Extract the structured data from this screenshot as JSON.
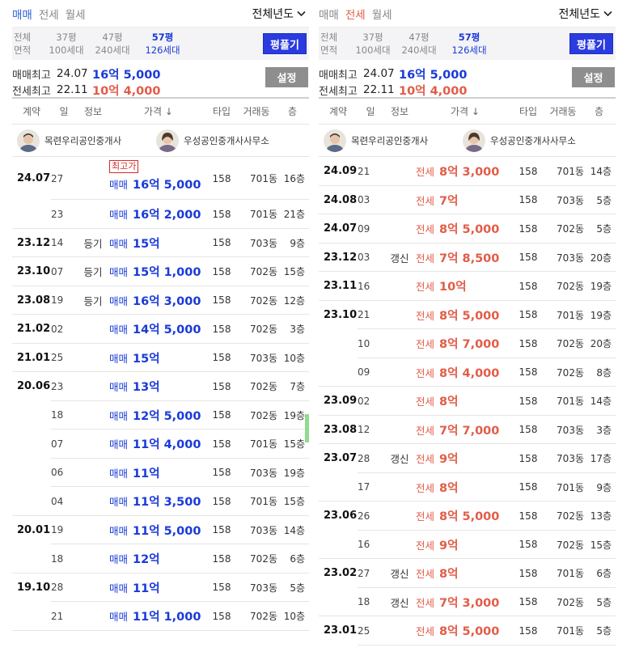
{
  "left": {
    "tabs": [
      {
        "label": "매매",
        "state": "active"
      },
      {
        "label": "전세",
        "state": "inactive"
      },
      {
        "label": "월세",
        "state": "inactive"
      }
    ],
    "year_select": "전체년도",
    "area": {
      "head_top": "전체",
      "head_bottom": "면적",
      "cols": [
        {
          "top": "37평",
          "bottom": "100세대"
        },
        {
          "top": "47평",
          "bottom": "240세대"
        },
        {
          "top": "57평",
          "bottom": "126세대"
        }
      ],
      "button": "평풀기"
    },
    "max": {
      "sale_label": "매매최고",
      "sale_date": "24.07",
      "sale_price": "16억 5,000",
      "jeonse_label": "전세최고",
      "jeonse_date": "22.11",
      "jeonse_price": "10억 4,000",
      "button": "설정"
    },
    "headers": {
      "contract": "계약",
      "day": "일",
      "info": "정보",
      "price": "가격 ↓",
      "type": "타입",
      "dong": "거래동",
      "floor": "층"
    },
    "agents": [
      {
        "name": "목련우리공인중개사"
      },
      {
        "name": "우성공인중개사사무소"
      }
    ],
    "rows": [
      {
        "date": "24.07",
        "day": "27",
        "info": "",
        "kind": "매매",
        "price": "16억 5,000",
        "type": "158",
        "dong": "701동",
        "floor": "16층",
        "badge": "최고가",
        "first": true,
        "last": false
      },
      {
        "date": "",
        "day": "23",
        "info": "",
        "kind": "매매",
        "price": "16억 2,000",
        "type": "158",
        "dong": "701동",
        "floor": "21층",
        "badge": "",
        "first": false,
        "last": true
      },
      {
        "date": "23.12",
        "day": "14",
        "info": "등기",
        "kind": "매매",
        "price": "15억",
        "type": "158",
        "dong": "703동",
        "floor": "9층",
        "badge": "",
        "first": true,
        "last": true
      },
      {
        "date": "23.10",
        "day": "07",
        "info": "등기",
        "kind": "매매",
        "price": "15억 1,000",
        "type": "158",
        "dong": "702동",
        "floor": "15층",
        "badge": "",
        "first": true,
        "last": true
      },
      {
        "date": "23.08",
        "day": "19",
        "info": "등기",
        "kind": "매매",
        "price": "16억 3,000",
        "type": "158",
        "dong": "702동",
        "floor": "12층",
        "badge": "",
        "first": true,
        "last": true
      },
      {
        "date": "21.02",
        "day": "02",
        "info": "",
        "kind": "매매",
        "price": "14억 5,000",
        "type": "158",
        "dong": "702동",
        "floor": "3층",
        "badge": "",
        "first": true,
        "last": true
      },
      {
        "date": "21.01",
        "day": "25",
        "info": "",
        "kind": "매매",
        "price": "15억",
        "type": "158",
        "dong": "703동",
        "floor": "10층",
        "badge": "",
        "first": true,
        "last": true
      },
      {
        "date": "20.06",
        "day": "23",
        "info": "",
        "kind": "매매",
        "price": "13억",
        "type": "158",
        "dong": "702동",
        "floor": "7층",
        "badge": "",
        "first": true,
        "last": false
      },
      {
        "date": "",
        "day": "18",
        "info": "",
        "kind": "매매",
        "price": "12억 5,000",
        "type": "158",
        "dong": "702동",
        "floor": "19층",
        "badge": "",
        "first": false,
        "last": false
      },
      {
        "date": "",
        "day": "07",
        "info": "",
        "kind": "매매",
        "price": "11억 4,000",
        "type": "158",
        "dong": "701동",
        "floor": "15층",
        "badge": "",
        "first": false,
        "last": false
      },
      {
        "date": "",
        "day": "06",
        "info": "",
        "kind": "매매",
        "price": "11억",
        "type": "158",
        "dong": "703동",
        "floor": "19층",
        "badge": "",
        "first": false,
        "last": false
      },
      {
        "date": "",
        "day": "04",
        "info": "",
        "kind": "매매",
        "price": "11억 3,500",
        "type": "158",
        "dong": "701동",
        "floor": "15층",
        "badge": "",
        "first": false,
        "last": true
      },
      {
        "date": "20.01",
        "day": "19",
        "info": "",
        "kind": "매매",
        "price": "11억 5,000",
        "type": "158",
        "dong": "703동",
        "floor": "14층",
        "badge": "",
        "first": true,
        "last": false
      },
      {
        "date": "",
        "day": "18",
        "info": "",
        "kind": "매매",
        "price": "12억",
        "type": "158",
        "dong": "702동",
        "floor": "6층",
        "badge": "",
        "first": false,
        "last": true
      },
      {
        "date": "19.10",
        "day": "28",
        "info": "",
        "kind": "매매",
        "price": "11억",
        "type": "158",
        "dong": "703동",
        "floor": "5층",
        "badge": "",
        "first": true,
        "last": false
      },
      {
        "date": "",
        "day": "21",
        "info": "",
        "kind": "매매",
        "price": "11억 1,000",
        "type": "158",
        "dong": "702동",
        "floor": "10층",
        "badge": "",
        "first": false,
        "last": true
      }
    ]
  },
  "right": {
    "tabs": [
      {
        "label": "매매",
        "state": "inactive"
      },
      {
        "label": "전세",
        "state": "active"
      },
      {
        "label": "월세",
        "state": "inactive"
      }
    ],
    "year_select": "전체년도",
    "area": {
      "head_top": "전체",
      "head_bottom": "면적",
      "cols": [
        {
          "top": "37평",
          "bottom": "100세대"
        },
        {
          "top": "47평",
          "bottom": "240세대"
        },
        {
          "top": "57평",
          "bottom": "126세대"
        }
      ],
      "button": "평풀기"
    },
    "max": {
      "sale_label": "매매최고",
      "sale_date": "24.07",
      "sale_price": "16억 5,000",
      "jeonse_label": "전세최고",
      "jeonse_date": "22.11",
      "jeonse_price": "10억 4,000",
      "button": "설정"
    },
    "headers": {
      "contract": "계약",
      "day": "일",
      "info": "정보",
      "price": "가격 ↓",
      "type": "타입",
      "dong": "거래동",
      "floor": "층"
    },
    "agents": [
      {
        "name": "목련우리공인중개사"
      },
      {
        "name": "우성공인중개사사무소"
      }
    ],
    "rows": [
      {
        "date": "24.09",
        "day": "21",
        "info": "",
        "kind": "전세",
        "price": "8억 3,000",
        "type": "158",
        "dong": "701동",
        "floor": "14층",
        "first": true,
        "last": true
      },
      {
        "date": "24.08",
        "day": "03",
        "info": "",
        "kind": "전세",
        "price": "7억",
        "type": "158",
        "dong": "703동",
        "floor": "5층",
        "first": true,
        "last": true
      },
      {
        "date": "24.07",
        "day": "09",
        "info": "",
        "kind": "전세",
        "price": "8억 5,000",
        "type": "158",
        "dong": "702동",
        "floor": "5층",
        "first": true,
        "last": true
      },
      {
        "date": "23.12",
        "day": "03",
        "info": "갱신",
        "kind": "전세",
        "price": "7억 8,500",
        "type": "158",
        "dong": "703동",
        "floor": "20층",
        "first": true,
        "last": true
      },
      {
        "date": "23.11",
        "day": "16",
        "info": "",
        "kind": "전세",
        "price": "10억",
        "type": "158",
        "dong": "702동",
        "floor": "19층",
        "first": true,
        "last": true
      },
      {
        "date": "23.10",
        "day": "21",
        "info": "",
        "kind": "전세",
        "price": "8억 5,000",
        "type": "158",
        "dong": "701동",
        "floor": "19층",
        "first": true,
        "last": false
      },
      {
        "date": "",
        "day": "10",
        "info": "",
        "kind": "전세",
        "price": "8억 7,000",
        "type": "158",
        "dong": "702동",
        "floor": "20층",
        "first": false,
        "last": false
      },
      {
        "date": "",
        "day": "09",
        "info": "",
        "kind": "전세",
        "price": "8억 4,000",
        "type": "158",
        "dong": "702동",
        "floor": "8층",
        "first": false,
        "last": true
      },
      {
        "date": "23.09",
        "day": "02",
        "info": "",
        "kind": "전세",
        "price": "8억",
        "type": "158",
        "dong": "701동",
        "floor": "14층",
        "first": true,
        "last": true
      },
      {
        "date": "23.08",
        "day": "12",
        "info": "",
        "kind": "전세",
        "price": "7억 7,000",
        "type": "158",
        "dong": "703동",
        "floor": "3층",
        "first": true,
        "last": true
      },
      {
        "date": "23.07",
        "day": "28",
        "info": "갱신",
        "kind": "전세",
        "price": "9억",
        "type": "158",
        "dong": "703동",
        "floor": "17층",
        "first": true,
        "last": false
      },
      {
        "date": "",
        "day": "17",
        "info": "",
        "kind": "전세",
        "price": "8억",
        "type": "158",
        "dong": "701동",
        "floor": "9층",
        "first": false,
        "last": true
      },
      {
        "date": "23.06",
        "day": "26",
        "info": "",
        "kind": "전세",
        "price": "8억 5,000",
        "type": "158",
        "dong": "702동",
        "floor": "13층",
        "first": true,
        "last": false
      },
      {
        "date": "",
        "day": "16",
        "info": "",
        "kind": "전세",
        "price": "9억",
        "type": "158",
        "dong": "702동",
        "floor": "15층",
        "first": false,
        "last": true
      },
      {
        "date": "23.02",
        "day": "27",
        "info": "갱신",
        "kind": "전세",
        "price": "8억",
        "type": "158",
        "dong": "701동",
        "floor": "6층",
        "first": true,
        "last": false
      },
      {
        "date": "",
        "day": "18",
        "info": "갱신",
        "kind": "전세",
        "price": "7억 3,000",
        "type": "158",
        "dong": "702동",
        "floor": "5층",
        "first": false,
        "last": true
      },
      {
        "date": "23.01",
        "day": "25",
        "info": "",
        "kind": "전세",
        "price": "8억 5,000",
        "type": "158",
        "dong": "701동",
        "floor": "5층",
        "first": true,
        "last": false
      }
    ]
  },
  "colors": {
    "sale_blue": "#1a3ad8",
    "jeonse_red": "#e25c47",
    "button_blue": "#2a3be0",
    "button_gray": "#8e8e8e"
  }
}
